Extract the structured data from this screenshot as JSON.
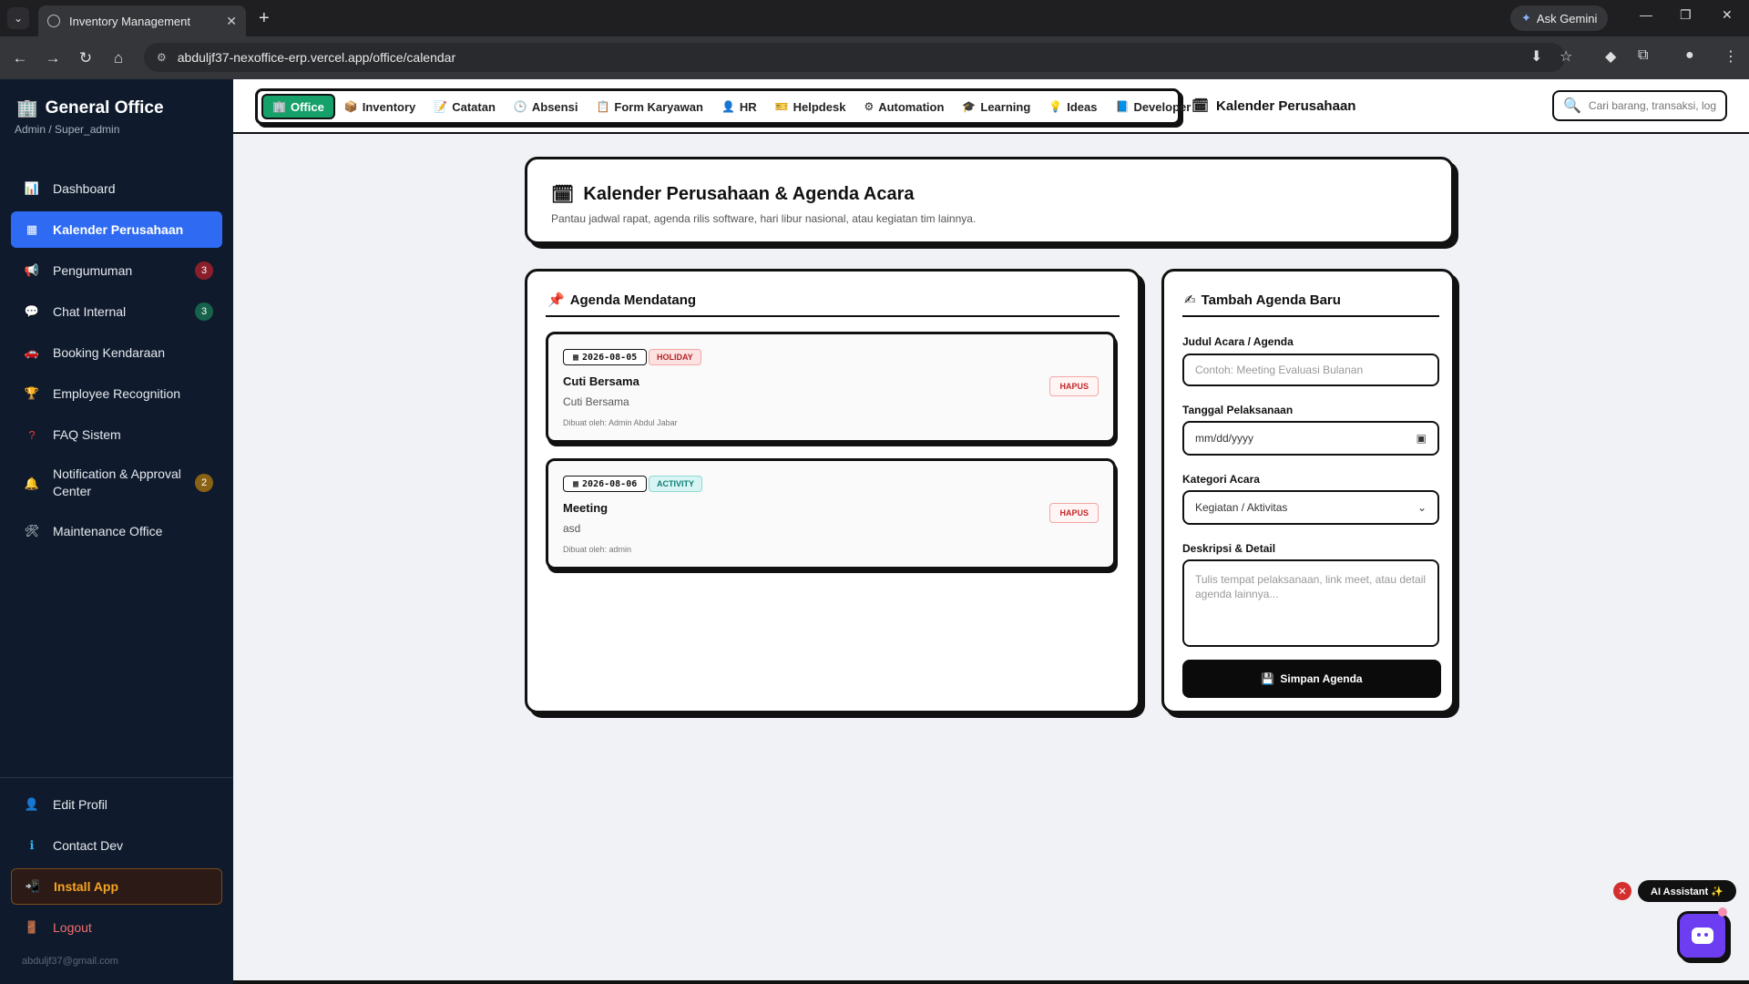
{
  "browser": {
    "tab_title": "Inventory Management",
    "url": "abduljf37-nexoffice-erp.vercel.app/office/calendar",
    "ask_gemini": "Ask Gemini"
  },
  "sidebar": {
    "brand": "General Office",
    "role": "Admin / Super_admin",
    "items": [
      {
        "label": "Dashboard",
        "icon": "chart-icon"
      },
      {
        "label": "Kalender Perusahaan",
        "icon": "calendar-icon",
        "active": true
      },
      {
        "label": "Pengumuman",
        "icon": "megaphone-icon",
        "badge": "3"
      },
      {
        "label": "Chat Internal",
        "icon": "chat-icon",
        "badge": "3"
      },
      {
        "label": "Booking Kendaraan",
        "icon": "car-icon"
      },
      {
        "label": "Employee Recognition",
        "icon": "trophy-icon"
      },
      {
        "label": "FAQ Sistem",
        "icon": "question-icon"
      },
      {
        "label": "Notification & Approval Center",
        "icon": "bell-icon",
        "badge": "2"
      },
      {
        "label": "Maintenance Office",
        "icon": "tools-icon"
      }
    ],
    "bottom": {
      "edit_profile": "Edit Profil",
      "contact_dev": "Contact Dev",
      "install_app": "Install App",
      "logout": "Logout"
    },
    "email": "abduljf37@gmail.com"
  },
  "modules": {
    "office": "Office",
    "inventory": "Inventory",
    "catatan": "Catatan",
    "absensi": "Absensi",
    "form_karyawan": "Form Karyawan",
    "hr": "HR",
    "helpdesk": "Helpdesk",
    "automation": "Automation",
    "learning": "Learning",
    "ideas": "Ideas",
    "developer": "Developer"
  },
  "breadcrumb": "Kalender Perusahaan",
  "search": {
    "placeholder": "Cari barang, transaksi, log..."
  },
  "header": {
    "title": "Kalender Perusahaan & Agenda Acara",
    "description": "Pantau jadwal rapat, agenda rilis software, hari libur nasional, atau kegiatan tim lainnya."
  },
  "agenda": {
    "title": "Agenda Mendatang",
    "delete_label": "HAPUS",
    "events": [
      {
        "date": "2026-08-05",
        "category": "HOLIDAY",
        "name": "Cuti Bersama",
        "description": "Cuti Bersama",
        "created_by": "Dibuat oleh: Admin Abdul Jabar"
      },
      {
        "date": "2026-08-06",
        "category": "ACTIVITY",
        "name": "Meeting",
        "description": "asd",
        "created_by": "Dibuat oleh: admin"
      }
    ]
  },
  "form": {
    "title": "Tambah Agenda Baru",
    "title_label": "Judul Acara / Agenda",
    "title_placeholder": "Contoh: Meeting Evaluasi Bulanan",
    "date_label": "Tanggal Pelaksanaan",
    "date_placeholder": "mm/dd/yyyy",
    "category_label": "Kategori Acara",
    "category_value": "Kegiatan / Aktivitas",
    "desc_label": "Deskripsi & Detail",
    "desc_placeholder": "Tulis tempat pelaksanaan, link meet, atau detail agenda lainnya...",
    "submit": "Simpan Agenda"
  },
  "assistant": {
    "label": "AI Assistant ✨"
  }
}
